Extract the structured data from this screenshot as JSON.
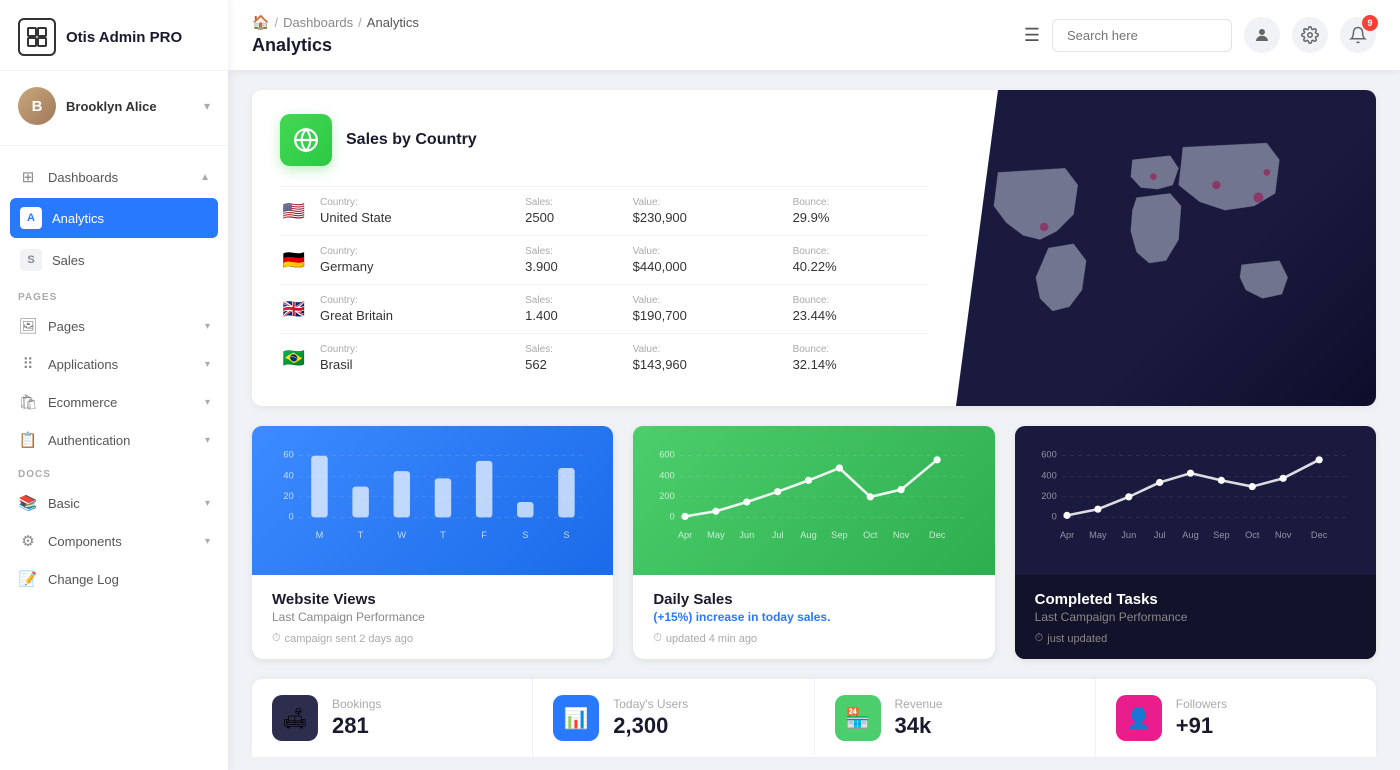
{
  "sidebar": {
    "logo": "Otis Admin PRO",
    "user": {
      "name": "Brooklyn Alice",
      "initials": "BA"
    },
    "nav": {
      "dashboards_label": "Dashboards",
      "analytics_label": "Analytics",
      "sales_label": "Sales",
      "pages_section": "PAGES",
      "pages_label": "Pages",
      "applications_label": "Applications",
      "ecommerce_label": "Ecommerce",
      "authentication_label": "Authentication",
      "docs_section": "DOCS",
      "basic_label": "Basic",
      "components_label": "Components",
      "changelog_label": "Change Log"
    }
  },
  "header": {
    "breadcrumb": {
      "home": "🏠",
      "sep1": "/",
      "dashboards": "Dashboards",
      "sep2": "/",
      "current": "Analytics"
    },
    "page_title": "Analytics",
    "menu_icon": "☰",
    "search_placeholder": "Search here",
    "notif_count": "9"
  },
  "sales_country": {
    "title": "Sales by Country",
    "columns": {
      "country": "Country:",
      "sales": "Sales:",
      "value": "Value:",
      "bounce": "Bounce:"
    },
    "rows": [
      {
        "flag": "🇺🇸",
        "country": "United State",
        "sales": "2500",
        "value": "$230,900",
        "bounce": "29.9%"
      },
      {
        "flag": "🇩🇪",
        "country": "Germany",
        "sales": "3.900",
        "value": "$440,000",
        "bounce": "40.22%"
      },
      {
        "flag": "🇬🇧",
        "country": "Great Britain",
        "sales": "1.400",
        "value": "$190,700",
        "bounce": "23.44%"
      },
      {
        "flag": "🇧🇷",
        "country": "Brasil",
        "sales": "562",
        "value": "$143,960",
        "bounce": "32.14%"
      }
    ]
  },
  "website_views": {
    "title": "Website Views",
    "subtitle": "Last Campaign Performance",
    "footer": "campaign sent 2 days ago",
    "bars": [
      60,
      30,
      45,
      38,
      55,
      15,
      48
    ],
    "x_labels": [
      "M",
      "T",
      "W",
      "T",
      "F",
      "S",
      "S"
    ],
    "y_labels": [
      "0",
      "20",
      "40",
      "60"
    ],
    "max": 60
  },
  "daily_sales": {
    "title": "Daily Sales",
    "badge": "(+15%)",
    "subtitle": "increase in today sales.",
    "footer": "updated 4 min ago",
    "y_labels": [
      "0",
      "200",
      "400",
      "600"
    ],
    "x_labels": [
      "Apr",
      "May",
      "Jun",
      "Jul",
      "Aug",
      "Sep",
      "Oct",
      "Nov",
      "Dec"
    ],
    "points": [
      10,
      50,
      120,
      240,
      360,
      480,
      200,
      280,
      520
    ],
    "max": 600
  },
  "completed_tasks": {
    "title": "Completed Tasks",
    "subtitle": "Last Campaign Performance",
    "footer": "just updated",
    "y_labels": [
      "0",
      "200",
      "400",
      "600"
    ],
    "x_labels": [
      "Apr",
      "May",
      "Jun",
      "Jul",
      "Aug",
      "Sep",
      "Oct",
      "Nov",
      "Dec"
    ],
    "points": [
      20,
      80,
      200,
      340,
      440,
      360,
      300,
      380,
      520
    ],
    "max": 600
  },
  "stats": [
    {
      "icon": "🛋",
      "icon_class": "stat-icon-dark",
      "label": "Bookings",
      "value": "281"
    },
    {
      "icon": "📊",
      "icon_class": "stat-icon-blue",
      "label": "Today's Users",
      "value": "2,300"
    },
    {
      "icon": "🏪",
      "icon_class": "stat-icon-green",
      "label": "Revenue",
      "value": "34k"
    },
    {
      "icon": "👤",
      "icon_class": "stat-icon-pink",
      "label": "Followers",
      "value": "+91"
    }
  ]
}
